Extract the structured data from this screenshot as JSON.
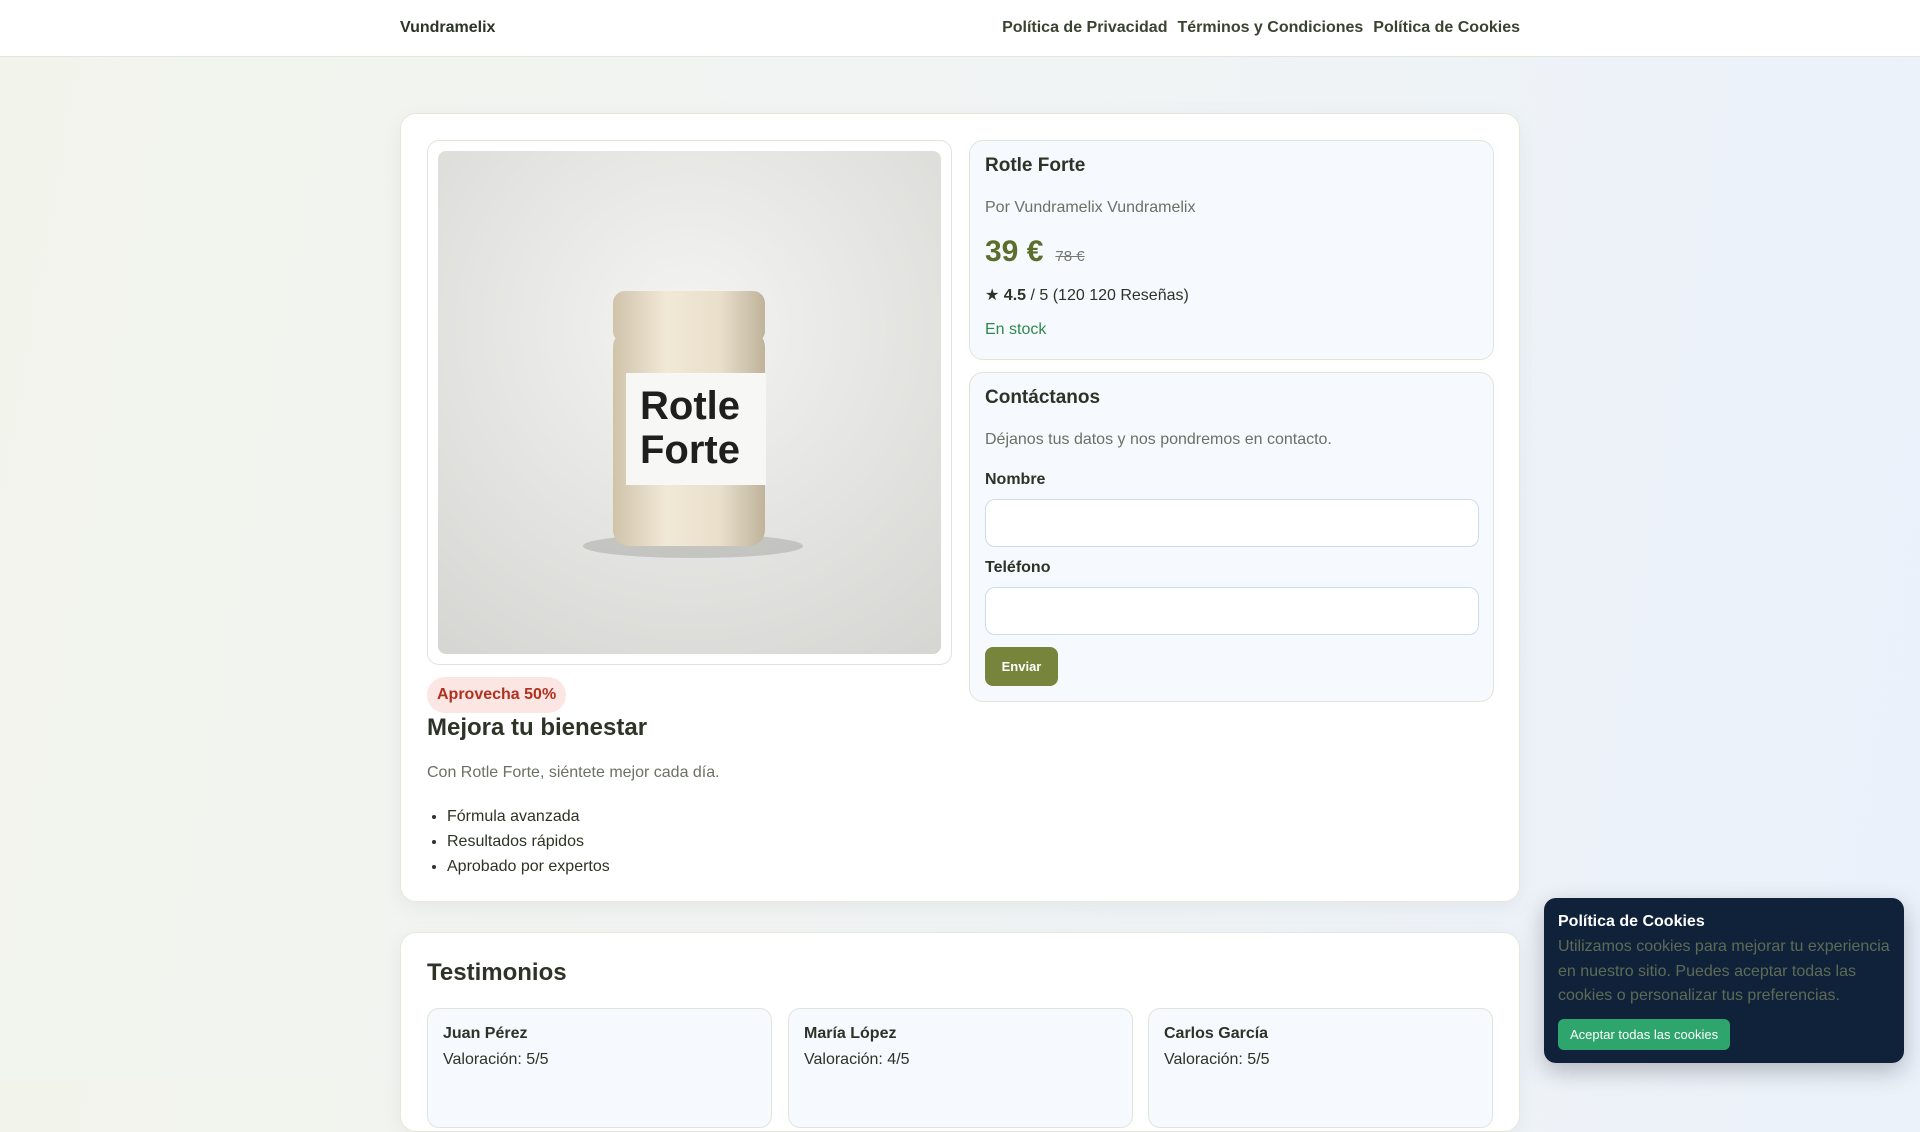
{
  "header": {
    "brand": "Vundramelix",
    "nav": [
      "Política de Privacidad",
      "Términos y Condiciones",
      "Política de Cookies"
    ]
  },
  "product": {
    "image_label": "Rotle Forte",
    "badge": "Aprovecha 50%",
    "heading": "Mejora tu bienestar",
    "description": "Con Rotle Forte, siéntete mejor cada día.",
    "features": [
      "Fórmula avanzada",
      "Resultados rápidos",
      "Aprobado por expertos"
    ],
    "title": "Rotle Forte",
    "by": "Por Vundramelix Vundramelix",
    "price": "39 €",
    "old_price": "78 €",
    "star": "★",
    "rating": "4.5",
    "rating_rest": " / 5 (120 120 Reseñas)",
    "stock": "En stock"
  },
  "contact": {
    "title": "Contáctanos",
    "subtitle": "Déjanos tus datos y nos pondremos en contacto.",
    "name_label": "Nombre",
    "phone_label": "Teléfono",
    "submit": "Enviar"
  },
  "testimonials": {
    "title": "Testimonios",
    "items": [
      {
        "name": "Juan Pérez",
        "rating": "Valoración: 5/5"
      },
      {
        "name": "María López",
        "rating": "Valoración: 4/5"
      },
      {
        "name": "Carlos García",
        "rating": "Valoración: 5/5"
      }
    ]
  },
  "cookie": {
    "title": "Política de Cookies",
    "text": "Utilizamos cookies para mejorar tu experiencia en nuestro sitio. Puedes aceptar todas las cookies o personalizar tus preferencias.",
    "accept": "Aceptar todas las cookies"
  }
}
